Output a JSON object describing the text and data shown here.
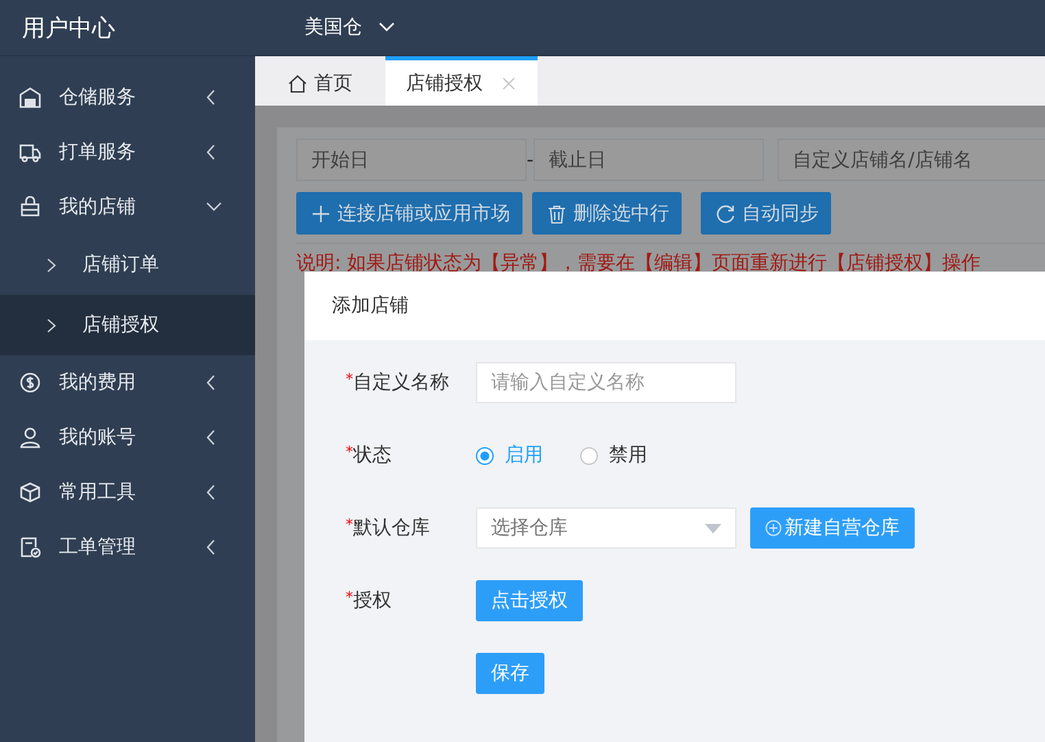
{
  "header": {
    "title": "用户中心",
    "warehouse": "美国仓"
  },
  "sidebar": {
    "items": [
      {
        "label": "仓储服务",
        "expanded": false
      },
      {
        "label": "打单服务",
        "expanded": false
      },
      {
        "label": "我的店铺",
        "expanded": true,
        "children": [
          {
            "label": "店铺订单",
            "selected": false
          },
          {
            "label": "店铺授权",
            "selected": true
          }
        ]
      },
      {
        "label": "我的费用",
        "expanded": false
      },
      {
        "label": "我的账号",
        "expanded": false
      },
      {
        "label": "常用工具",
        "expanded": false
      },
      {
        "label": "工单管理",
        "expanded": false
      }
    ]
  },
  "tabs": [
    {
      "label": "首页",
      "selected": false,
      "closable": false
    },
    {
      "label": "店铺授权",
      "selected": true,
      "closable": true
    }
  ],
  "filters": {
    "start_date": {
      "placeholder": "开始日"
    },
    "separator": "-",
    "end_date": {
      "placeholder": "截止日"
    },
    "search": {
      "placeholder": "自定义店铺名/店铺名"
    }
  },
  "toolbar": [
    {
      "label": "连接店铺或应用市场",
      "kind": "add"
    },
    {
      "label": "删除选中行",
      "kind": "delete"
    },
    {
      "label": "自动同步",
      "kind": "sync"
    }
  ],
  "notice": "说明: 如果店铺状态为【异常】，需要在【编辑】页面重新进行【店铺授权】操作",
  "dialog": {
    "title": "添加店铺",
    "fields": [
      {
        "kind": "text",
        "mark": "*",
        "label": "自定义名称",
        "placeholder": "请输入自定义名称"
      },
      {
        "kind": "radio",
        "mark": "*",
        "label": "状态",
        "options": [
          {
            "label": "启用",
            "selected": true
          },
          {
            "label": "禁用",
            "selected": false
          }
        ]
      },
      {
        "kind": "select",
        "mark": "*",
        "label": "默认仓库",
        "placeholder": "选择仓库",
        "action": "新建自营仓库"
      },
      {
        "kind": "button",
        "mark": "*",
        "label": "授权",
        "button": "点击授权"
      }
    ],
    "submit": "保存"
  }
}
